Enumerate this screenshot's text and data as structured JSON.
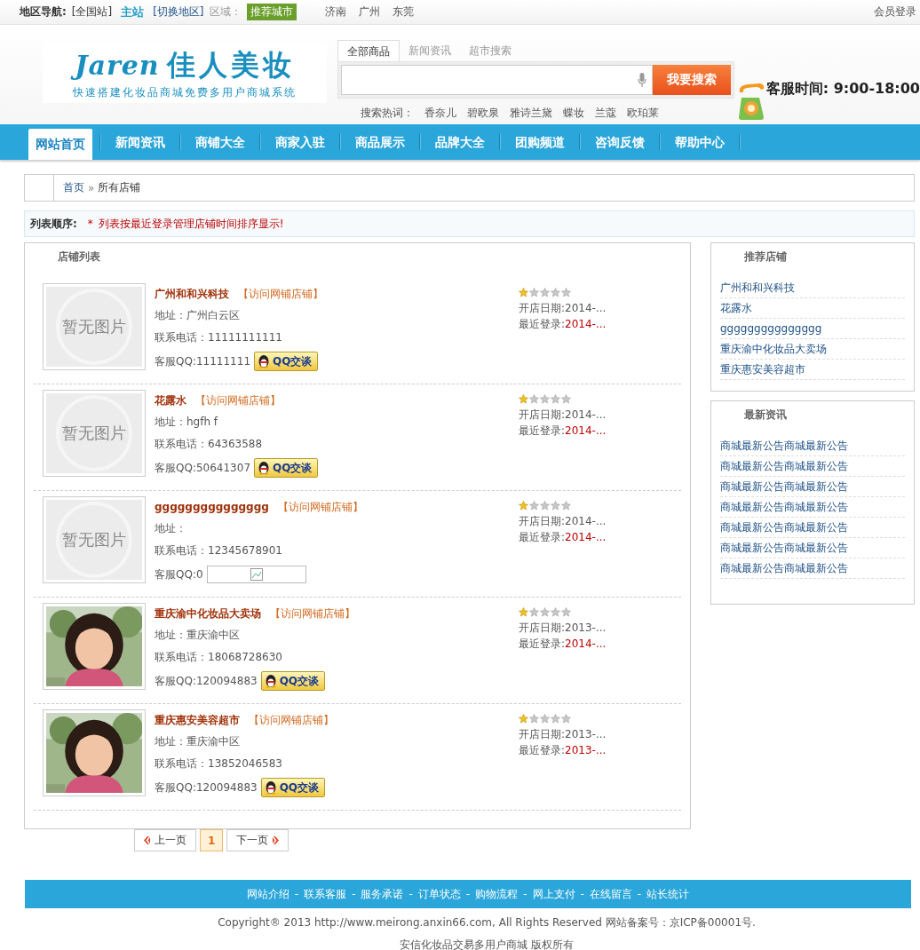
{
  "top_bar": {
    "nav_label": "地区导航:",
    "all_site": "[全国站]",
    "main_site": "主站",
    "switch_region": "[切换地区]",
    "region_label": "区域：",
    "recommended_badge": "推荐城市",
    "cities": [
      "济南",
      "广州",
      "东莞"
    ],
    "login": "会员登录"
  },
  "header": {
    "logo_word": "Jaren",
    "logo_title": "佳人美妆",
    "logo_slogan": "快速搭建化妆品商城免费多用户商城系统",
    "search_tabs": [
      {
        "label": "全部商品",
        "selected": true
      },
      {
        "label": "新闻资讯",
        "selected": false
      },
      {
        "label": "超市搜索",
        "selected": false
      }
    ],
    "search_button": "我要搜索",
    "hot_label": "搜索热词：",
    "hot_words": [
      "香奈儿",
      "碧欧泉",
      "雅诗兰黛",
      "蝶妆",
      "兰蔻",
      "欧珀莱"
    ],
    "service_hours": "客服时间: 9:00-18:00"
  },
  "nav": [
    {
      "label": "网站首页",
      "selected": true
    },
    {
      "label": "新闻资讯",
      "selected": false
    },
    {
      "label": "商铺大全",
      "selected": false
    },
    {
      "label": "商家入驻",
      "selected": false
    },
    {
      "label": "商品展示",
      "selected": false
    },
    {
      "label": "品牌大全",
      "selected": false
    },
    {
      "label": "团购频道",
      "selected": false
    },
    {
      "label": "咨询反馈",
      "selected": false
    },
    {
      "label": "帮助中心",
      "selected": false
    }
  ],
  "breadcrumb": {
    "home": "首页",
    "sep": "»",
    "current": "所有店铺"
  },
  "notice": {
    "label": "列表顺序:",
    "star": "*",
    "text": "列表按最近登录管理店铺时间排序显示!"
  },
  "shop_list": {
    "title": "店铺列表",
    "shops": [
      {
        "name": "广州和和兴科技",
        "visit_label": "【访问网铺店铺】",
        "image": {
          "kind": "none",
          "text": "暂无图片"
        },
        "address_label": "地址：",
        "address": "广州白云区",
        "phone_label": "联系电话：",
        "phone": "11111111111",
        "qq_label": "客服QQ:",
        "qq": "11111111",
        "chat": {
          "kind": "button",
          "label": "QQ交谈"
        },
        "stars": 1,
        "open_label": "开店日期:",
        "opened": "2014-...",
        "login_label": "最近登录:",
        "last_login": "2014-..."
      },
      {
        "name": "花露水",
        "visit_label": "【访问网铺店铺】",
        "image": {
          "kind": "none",
          "text": "暂无图片"
        },
        "address_label": "地址：",
        "address": "hgfh f",
        "phone_label": "联系电话：",
        "phone": "64363588",
        "qq_label": "客服QQ:",
        "qq": "50641307",
        "chat": {
          "kind": "button",
          "label": "QQ交谈"
        },
        "stars": 1,
        "open_label": "开店日期:",
        "opened": "2014-...",
        "login_label": "最近登录:",
        "last_login": "2014-..."
      },
      {
        "name": "ggggggggggggggg",
        "visit_label": "【访问网铺店铺】",
        "image": {
          "kind": "none",
          "text": "暂无图片"
        },
        "address_label": "地址：",
        "phone_label": "联系电话：",
        "phone": "12345678901",
        "qq_label": "客服QQ:",
        "qq": "0",
        "chat": {
          "kind": "broken"
        },
        "stars": 1,
        "open_label": "开店日期:",
        "opened": "2014-...",
        "login_label": "最近登录:",
        "last_login": "2014-..."
      },
      {
        "name": "重庆渝中化妆品大卖场",
        "visit_label": "【访问网铺店铺】",
        "address_label": "地址：",
        "address": "重庆渝中区",
        "phone_label": "联系电话：",
        "phone": "18068728630",
        "qq_label": "客服QQ:",
        "qq": "120094883",
        "chat": {
          "kind": "button",
          "label": "QQ交谈"
        },
        "stars": 1,
        "open_label": "开店日期:",
        "opened": "2013-...",
        "login_label": "最近登录:",
        "last_login": "2014-..."
      },
      {
        "name": "重庆惠安美容超市",
        "visit_label": "【访问网铺店铺】",
        "address_label": "地址：",
        "address": "重庆渝中区",
        "phone_label": "联系电话：",
        "phone": "13852046583",
        "qq_label": "客服QQ:",
        "qq": "120094883",
        "chat": {
          "kind": "button",
          "label": "QQ交谈"
        },
        "stars": 1,
        "open_label": "开店日期:",
        "opened": "2013-...",
        "login_label": "最近登录:",
        "last_login": "2013-..."
      }
    ]
  },
  "pagination": {
    "prev": "上一页",
    "pages": [
      {
        "label": "1",
        "selected": true
      }
    ],
    "next": "下一页"
  },
  "recommended": {
    "title": "推荐店铺",
    "items": [
      "广州和和兴科技",
      "花露水",
      "ggggggggggggggg",
      "重庆渝中化妆品大卖场",
      "重庆惠安美容超市"
    ]
  },
  "news": {
    "title": "最新资讯",
    "items": [
      "商城最新公告商城最新公告",
      "商城最新公告商城最新公告",
      "商城最新公告商城最新公告",
      "商城最新公告商城最新公告",
      "商城最新公告商城最新公告",
      "商城最新公告商城最新公告",
      "商城最新公告商城最新公告"
    ]
  },
  "footer": {
    "links": [
      "网站介绍",
      "联系客服",
      "服务承诺",
      "订单状态",
      "购物流程",
      "网上支付",
      "在线留言",
      "站长统计"
    ],
    "sep": "-",
    "copyright": "Copyright® 2013 http://www.meirong.anxin66.com, All Rights Reserved  网站备案号：京ICP备00001号.",
    "owner": "安信化妆品交易多用户商城 版权所有"
  }
}
